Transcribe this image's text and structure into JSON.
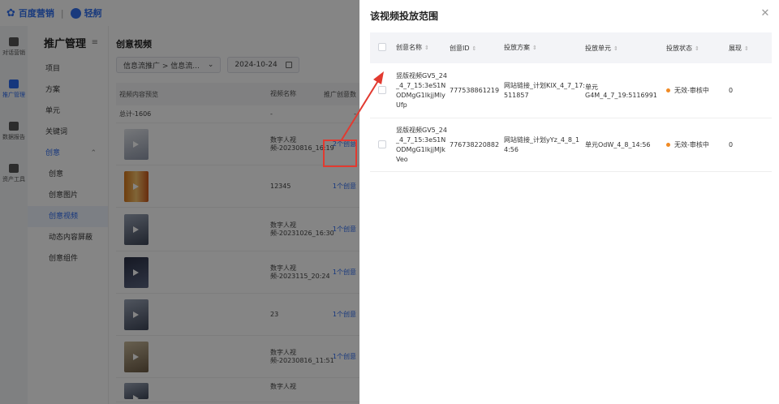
{
  "topbar": {
    "brand1": "百度营销",
    "brand2": "轻舸"
  },
  "rail": [
    {
      "label": "对话营销",
      "icon": "chat-icon"
    },
    {
      "label": "推广管理",
      "icon": "chart-icon",
      "active": true
    },
    {
      "label": "数据报告",
      "icon": "report-icon"
    },
    {
      "label": "资产工具",
      "icon": "tool-icon"
    }
  ],
  "sidenav": {
    "title": "推广管理",
    "collapse_icon": "menu-collapse-icon",
    "items": [
      "项目",
      "方案",
      "单元",
      "关键词"
    ],
    "group": "创意",
    "sub_items": [
      "创意",
      "创意图片",
      "创意视频",
      "动态内容屏蔽",
      "创意组件"
    ],
    "active": "创意视频"
  },
  "main": {
    "title": "创意视频",
    "filter_path": "信息流推广 > 信息流...",
    "filter_date": "2024-10-24",
    "columns": [
      "视频内容预览",
      "视频名称",
      "推广创意数"
    ],
    "total_row": {
      "label": "总计-1606",
      "name": "-",
      "count": "-"
    },
    "rows": [
      {
        "name": "数字人视频-20230816_16:19",
        "count": "2个创意"
      },
      {
        "name": "12345",
        "count": "1个创意"
      },
      {
        "name": "数字人视频-20231026_16:30",
        "count": "1个创意"
      },
      {
        "name": "数字人视频-2023115_20:24",
        "count": "1个创意"
      },
      {
        "name": "23",
        "count": "1个创意"
      },
      {
        "name": "数字人视频-20230816_11:51",
        "count": "1个创意"
      },
      {
        "name": "数字人视",
        "count": ""
      }
    ]
  },
  "drawer": {
    "title": "该视频投放范围",
    "columns": [
      "创意名称",
      "创意ID",
      "投放方案",
      "投放单元",
      "投放状态",
      "展现"
    ],
    "rows": [
      {
        "name": "竖版视频GV5_24_4_7_15:3eS1NODMgG1lkjjMlyUfp",
        "id": "777538861219",
        "plan": "网站链接_计划KlX_4_7_17:511857",
        "unit": "单元G4M_4_7_19:5116991",
        "status": "无效-审核中",
        "shows": "0"
      },
      {
        "name": "竖版视频GV5_24_4_7_15:3eS1NODMgG1lkjjMJkVeo",
        "id": "776738220882",
        "plan": "网站链接_计划yYz_4_8_14:56",
        "unit": "单元OdW_4_8_14:56",
        "status": "无效-审核中",
        "shows": "0"
      }
    ]
  },
  "colors": {
    "accent": "#2b6af0",
    "status_dot": "#f08a24",
    "highlight": "#e23a30"
  }
}
